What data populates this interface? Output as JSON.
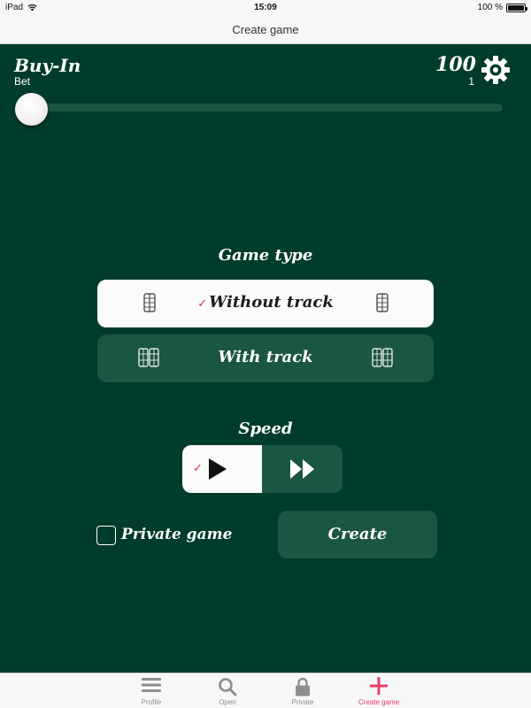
{
  "status_bar": {
    "device": "iPad",
    "time": "15:09",
    "battery_text": "100 %",
    "battery_level": 1.0
  },
  "nav": {
    "title": "Create game"
  },
  "buy_in": {
    "title": "Buy-In",
    "subtitle": "Bet",
    "value": "100",
    "count": "1",
    "slider_fraction": 0.0
  },
  "game_type": {
    "title": "Game type",
    "options": [
      {
        "label": "Without track",
        "selected": true,
        "icon": "single-board-icon"
      },
      {
        "label": "With track",
        "selected": false,
        "icon": "double-board-icon"
      }
    ]
  },
  "speed": {
    "title": "Speed",
    "options": [
      {
        "icon": "play-icon",
        "selected": true
      },
      {
        "icon": "fast-forward-icon",
        "selected": false
      }
    ]
  },
  "private_game": {
    "label": "Private game",
    "checked": false
  },
  "create_button": {
    "label": "Create"
  },
  "tabs": [
    {
      "label": "Profile",
      "icon": "menu-icon",
      "active": false
    },
    {
      "label": "Open",
      "icon": "search-icon",
      "active": false
    },
    {
      "label": "Private",
      "icon": "lock-icon",
      "active": false
    },
    {
      "label": "Create game",
      "icon": "plus-icon",
      "active": true
    }
  ],
  "colors": {
    "felt": "#003c2b",
    "option_dark": "#1b5543",
    "option_light": "#fbfbfb",
    "check": "#e0313b",
    "tab_active": "#e8406a",
    "tab_inactive": "#8e8e8e"
  }
}
